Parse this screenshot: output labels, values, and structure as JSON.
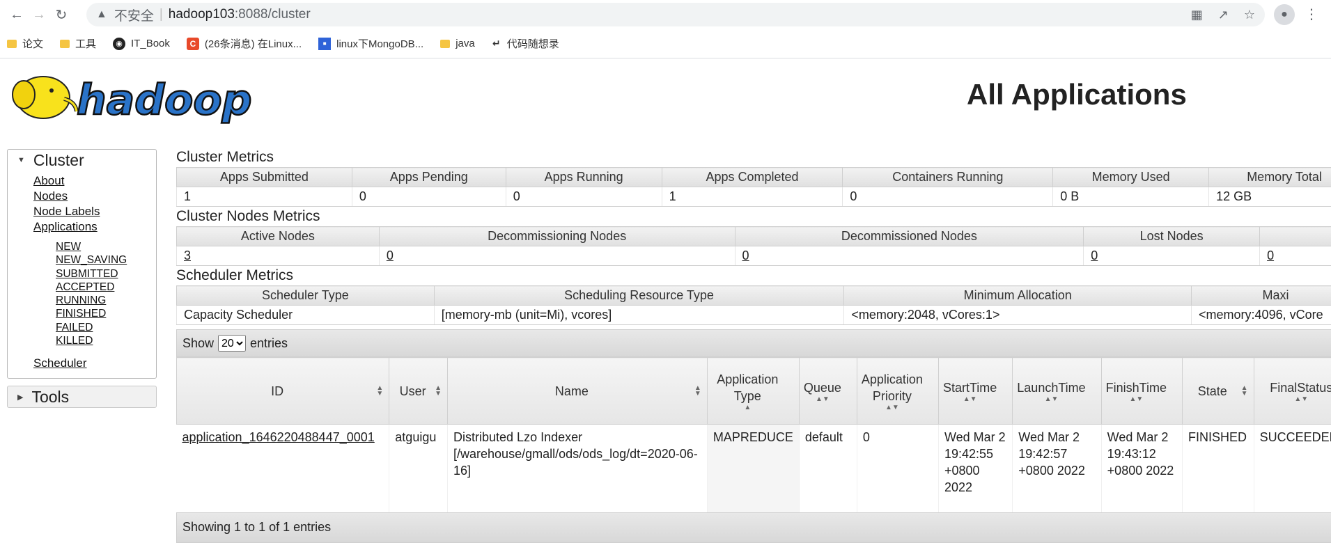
{
  "browser": {
    "insecure_label": "不安全",
    "url_host": "hadoop103",
    "url_rest": ":8088/cluster"
  },
  "bookmarks": [
    {
      "label": "论文",
      "icon": "folder-icon"
    },
    {
      "label": "工具",
      "icon": "folder-icon"
    },
    {
      "label": "IT_Book",
      "icon": "github-icon"
    },
    {
      "label": "(26条消息) 在Linux...",
      "icon": "csdn-icon"
    },
    {
      "label": "linux下MongoDB...",
      "icon": "baidu-icon"
    },
    {
      "label": "java",
      "icon": "folder-icon"
    },
    {
      "label": "代码随想录",
      "icon": "site-icon"
    }
  ],
  "page": {
    "title": "All Applications",
    "logo_text": "hadoop"
  },
  "sidebar": {
    "cluster_label": "Cluster",
    "links": [
      "About",
      "Nodes",
      "Node Labels",
      "Applications"
    ],
    "states": [
      "NEW",
      "NEW_SAVING",
      "SUBMITTED",
      "ACCEPTED",
      "RUNNING",
      "FINISHED",
      "FAILED",
      "KILLED"
    ],
    "scheduler_label": "Scheduler",
    "tools_label": "Tools"
  },
  "cluster_metrics": {
    "title": "Cluster Metrics",
    "headers": [
      "Apps Submitted",
      "Apps Pending",
      "Apps Running",
      "Apps Completed",
      "Containers Running",
      "Memory Used",
      "Memory Total"
    ],
    "values": [
      "1",
      "0",
      "0",
      "1",
      "0",
      "0 B",
      "12 GB"
    ]
  },
  "node_metrics": {
    "title": "Cluster Nodes Metrics",
    "headers": [
      "Active Nodes",
      "Decommissioning Nodes",
      "Decommissioned Nodes",
      "Lost Nodes",
      ""
    ],
    "values": [
      "3",
      "0",
      "0",
      "0",
      "0"
    ]
  },
  "scheduler_metrics": {
    "title": "Scheduler Metrics",
    "headers": [
      "Scheduler Type",
      "Scheduling Resource Type",
      "Minimum Allocation",
      "Maxi"
    ],
    "values": [
      "Capacity Scheduler",
      "[memory-mb (unit=Mi), vcores]",
      "<memory:2048, vCores:1>",
      "<memory:4096, vCore"
    ]
  },
  "datatable": {
    "show_label": "Show",
    "page_size": "20",
    "entries_label": "entries",
    "headers": [
      "ID",
      "User",
      "Name",
      "Application Type",
      "Queue",
      "Application Priority",
      "StartTime",
      "LaunchTime",
      "FinishTime",
      "State",
      "FinalStatus"
    ],
    "row": {
      "id": "application_1646220488447_0001",
      "user": "atguigu",
      "name": "Distributed Lzo Indexer [/warehouse/gmall/ods/ods_log/dt=2020-06-16]",
      "type": "MAPREDUCE",
      "queue": "default",
      "priority": "0",
      "start": "Wed Mar 2 19:42:55 +0800 2022",
      "launch": "Wed Mar 2 19:42:57 +0800 2022",
      "finish": "Wed Mar 2 19:43:12 +0800 2022",
      "state": "FINISHED",
      "final_status": "SUCCEEDED"
    },
    "footer": "Showing 1 to 1 of 1 entries"
  }
}
